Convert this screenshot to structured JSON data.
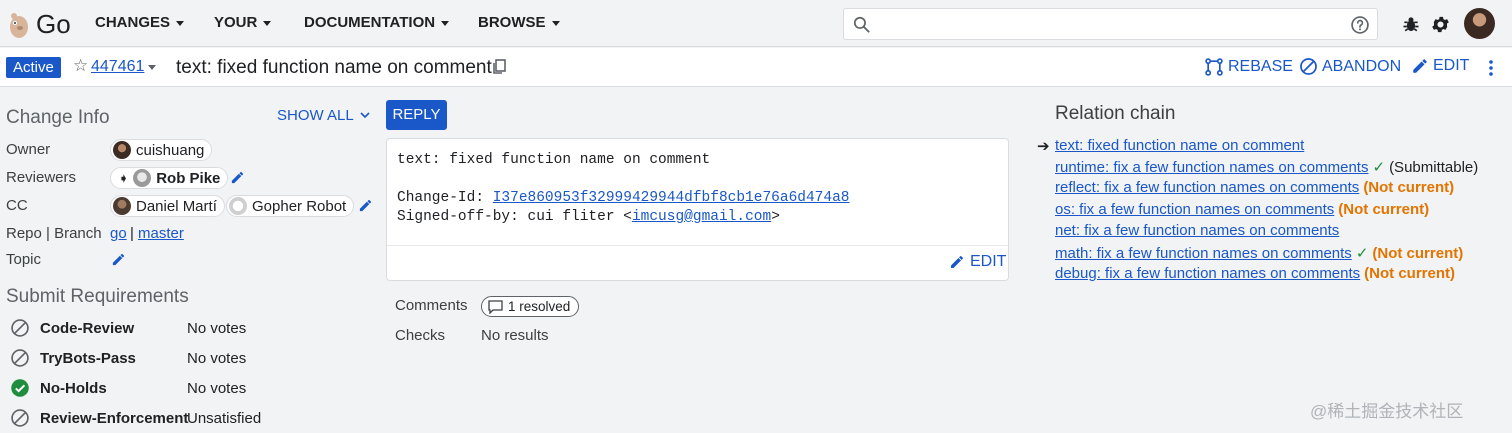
{
  "app": {
    "logo_text": "Go"
  },
  "nav": [
    {
      "label": "CHANGES"
    },
    {
      "label": "YOUR"
    },
    {
      "label": "DOCUMENTATION"
    },
    {
      "label": "BROWSE"
    }
  ],
  "search": {
    "placeholder": "",
    "value": ""
  },
  "change": {
    "status": "Active",
    "number": "447461",
    "title": "text: fixed function name on comment",
    "actions": {
      "rebase": "REBASE",
      "abandon": "ABANDON",
      "edit": "EDIT"
    }
  },
  "change_info": {
    "title": "Change Info",
    "show_all": "SHOW ALL",
    "owner_label": "Owner",
    "owner": "cuishuang",
    "reviewers_label": "Reviewers",
    "reviewer": "Rob Pike",
    "cc_label": "CC",
    "cc": [
      "Daniel Martí",
      "Gopher Robot"
    ],
    "repo_label": "Repo | Branch",
    "repo": "go",
    "separator": "|",
    "branch": "master",
    "topic_label": "Topic"
  },
  "submit_requirements": {
    "title": "Submit Requirements",
    "rows": [
      {
        "name": "Code-Review",
        "value": "No votes",
        "status": "blocked"
      },
      {
        "name": "TryBots-Pass",
        "value": "No votes",
        "status": "blocked"
      },
      {
        "name": "No-Holds",
        "value": "No votes",
        "status": "satisfied"
      },
      {
        "name": "Review-Enforcement",
        "value": "Unsatisfied",
        "status": "blocked"
      }
    ]
  },
  "reply": {
    "label": "REPLY"
  },
  "commit_message": {
    "line1": "text: fixed function name on comment",
    "change_id_label": "Change-Id: ",
    "change_id": "I37e860953f32999429944dfbf8cb1e76a6d474a8",
    "signed_off_label": "Signed-off-by: cui fliter <",
    "email": "imcusg@gmail.com",
    "signed_off_end": ">",
    "edit_label": "EDIT"
  },
  "comments": {
    "label": "Comments",
    "chip": "1 resolved"
  },
  "checks": {
    "label": "Checks",
    "value": "No results"
  },
  "relation_chain": {
    "title": "Relation chain",
    "arrow": "➔",
    "items": [
      {
        "text": "text: fixed function name on comment",
        "status": "",
        "check": ""
      },
      {
        "text": "runtime: fix a few function names on comments",
        "status": "(Submittable)",
        "check": "✓"
      },
      {
        "text": "reflect: fix a few function names on comments",
        "status": "(Not current)",
        "check": ""
      },
      {
        "text": "os: fix a few function names on comments",
        "status": "(Not current)",
        "check": ""
      },
      {
        "text": "net: fix a few function names on comments",
        "status": "",
        "check": ""
      },
      {
        "text": "math: fix a few function names on comments",
        "status": "(Not current)",
        "check": "✓"
      },
      {
        "text": "debug: fix a few function names on comments",
        "status": "(Not current)",
        "check": ""
      }
    ]
  },
  "watermark": "@稀土掘金技术社区",
  "colors": {
    "accent": "#1a57c8",
    "warning": "#e37400",
    "success": "#1e8e3e"
  }
}
